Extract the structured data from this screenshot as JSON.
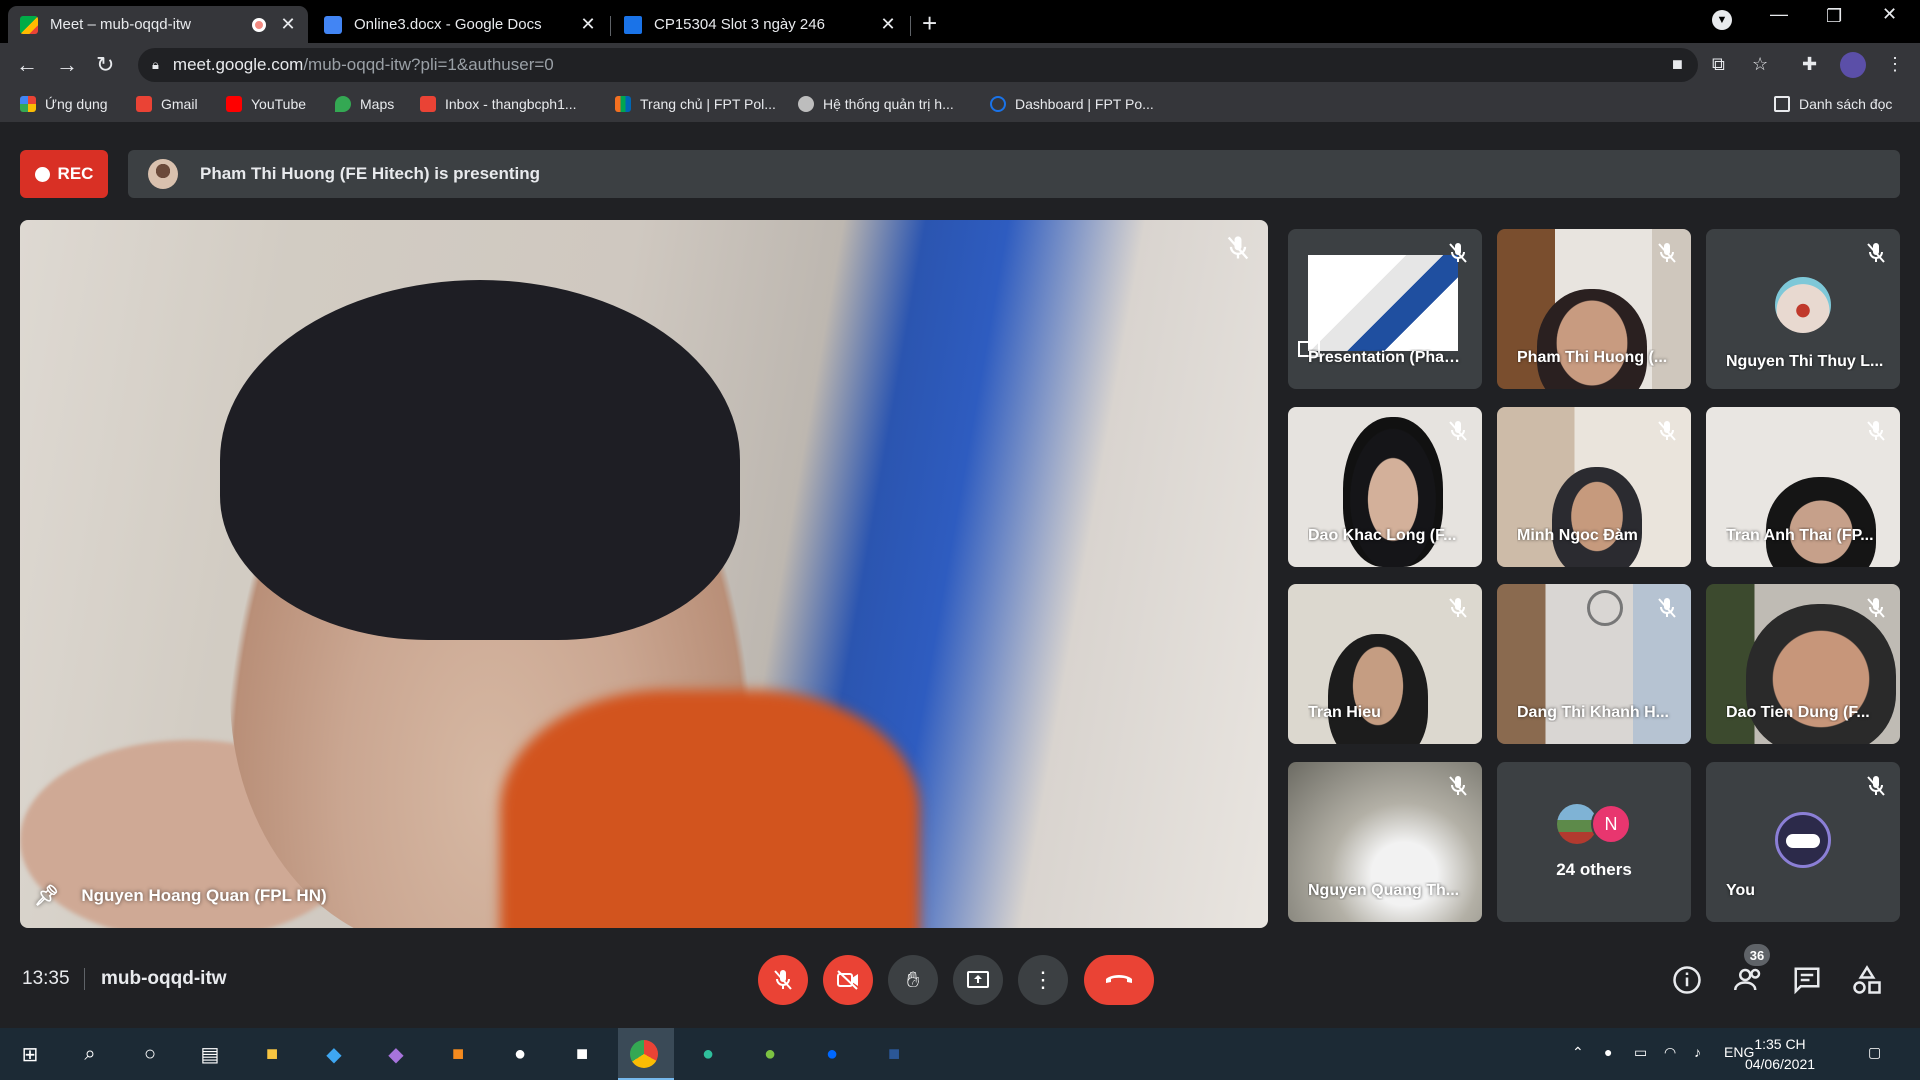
{
  "browser": {
    "tabs": [
      {
        "title": "Meet – mub-oqqd-itw",
        "active": true,
        "favicon_color": "#00ac47"
      },
      {
        "title": "Online3.docx - Google Docs",
        "active": false,
        "favicon_color": "#4285f4"
      },
      {
        "title": "CP15304 Slot 3 ngày 246",
        "active": false,
        "favicon_color": "#1a73e8"
      }
    ],
    "url_host": "meet.google.com",
    "url_path": "/mub-oqqd-itw?pli=1&authuser=0",
    "bookmarks": [
      {
        "label": "Ứng dụng",
        "icon": "apps-grid-icon",
        "color": "#4285f4"
      },
      {
        "label": "Gmail",
        "icon": "gmail-icon",
        "color": "#ea4335"
      },
      {
        "label": "YouTube",
        "icon": "youtube-icon",
        "color": "#ff0000"
      },
      {
        "label": "Maps",
        "icon": "maps-icon",
        "color": "#34a853"
      },
      {
        "label": "Inbox - thangbcph1...",
        "icon": "gmail-icon",
        "color": "#ea4335"
      },
      {
        "label": "Trang chủ | FPT Pol...",
        "icon": "fpt-icon",
        "color": "#f37021"
      },
      {
        "label": "Hệ thống quản trị h...",
        "icon": "cloud-icon",
        "color": "#bdbdbd"
      },
      {
        "label": "Dashboard | FPT Po...",
        "icon": "circle-icon",
        "color": "#1a73e8"
      }
    ],
    "reading_list": "Danh sách đọc"
  },
  "meet": {
    "rec_label": "REC",
    "presenting_text": "Pham Thi Huong (FE Hitech) is presenting",
    "main_speaker": "Nguyen Hoang Quan (FPL HN)",
    "tiles": [
      {
        "name": "Presentation (Pham Thi Hu...",
        "type": "presentation"
      },
      {
        "name": "Pham Thi Huong (...",
        "type": "video"
      },
      {
        "name": "Nguyen Thi Thuy L...",
        "type": "avatar"
      },
      {
        "name": "Dao Khac Long (F...",
        "type": "video"
      },
      {
        "name": "Minh Ngoc Đàm",
        "type": "video"
      },
      {
        "name": "Tran Anh Thai (FP...",
        "type": "video"
      },
      {
        "name": "Tran Hieu",
        "type": "video"
      },
      {
        "name": "Dang Thi Khanh H...",
        "type": "video"
      },
      {
        "name": "Dao Tien Dung (F...",
        "type": "video"
      },
      {
        "name": "Nguyen Quang Th...",
        "type": "video"
      },
      {
        "name": "24 others",
        "type": "others",
        "initial": "N"
      },
      {
        "name": "You",
        "type": "you"
      }
    ],
    "time": "13:35",
    "meeting_code": "mub-oqqd-itw",
    "people_count": "36",
    "accent_red": "#ea4335"
  },
  "taskbar": {
    "language": "ENG",
    "clock_time": "1:35 CH",
    "clock_date": "04/06/2021"
  }
}
